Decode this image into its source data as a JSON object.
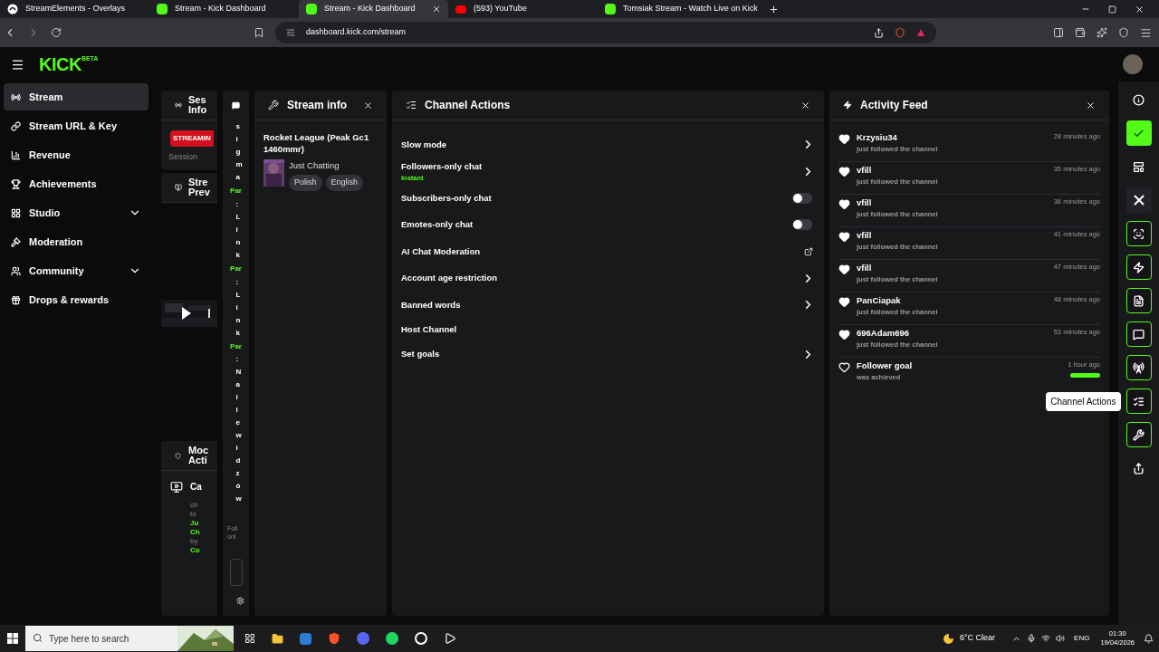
{
  "browser": {
    "tabs": [
      {
        "title": "StreamElements - Overlays",
        "kind": "streamelements",
        "selected": false
      },
      {
        "title": "Stream - Kick Dashboard",
        "kind": "kick",
        "selected": false
      },
      {
        "title": "Stream - Kick Dashboard",
        "kind": "kick",
        "selected": true
      },
      {
        "title": "(593) YouTube",
        "kind": "youtube",
        "selected": false
      },
      {
        "title": "Tomsiak Stream - Watch Live on Kick",
        "kind": "kick",
        "selected": false
      }
    ],
    "address": "dashboard.kick.com/stream"
  },
  "header": {
    "logo": "KICK",
    "badge": "BETA"
  },
  "sidebar": {
    "items": [
      {
        "label": "Stream",
        "selected": true
      },
      {
        "label": "Stream URL & Key",
        "selected": false
      },
      {
        "label": "Revenue",
        "selected": false
      },
      {
        "label": "Achievements",
        "selected": false
      },
      {
        "label": "Studio",
        "selected": false,
        "expanded": false
      },
      {
        "label": "Moderation",
        "selected": false
      },
      {
        "label": "Community",
        "selected": false,
        "expanded": false
      },
      {
        "label": "Drops & rewards",
        "selected": false
      }
    ]
  },
  "session_panel": {
    "title_lines": [
      "Ses",
      "Info"
    ],
    "status": "STREAMIN",
    "label": "Session",
    "preview_lines": [
      "Stre",
      "Prev"
    ],
    "mod_lines": [
      "Moc",
      "Acti"
    ],
    "mod_item": "Ca",
    "mod_text": [
      {
        "text": "ch",
        "green": false
      },
      {
        "text": "to",
        "green": false
      },
      {
        "text": "Ju",
        "green": true
      },
      {
        "text": "Ch",
        "green": true
      },
      {
        "text": "by",
        "green": false
      },
      {
        "text": "Co",
        "green": true
      }
    ]
  },
  "chat_panel": {
    "messages": [
      {
        "text": "sigma"
      },
      {
        "user": "Par",
        "text": ":Link"
      },
      {
        "user": "Par",
        "text": ":Link"
      },
      {
        "user": "Par",
        "text": ":Nailewidzów"
      }
    ],
    "footer_lines": [
      "Foll",
      "onl"
    ]
  },
  "stream_info": {
    "title": "Stream info",
    "stream_title": "Rocket League (Peak Gc1 1460mmr)",
    "category": "Just Chatting",
    "tags": [
      "Polish",
      "English"
    ]
  },
  "channel_actions": {
    "title": "Channel Actions",
    "rows": [
      {
        "label": "Slow mode",
        "kind": "arrow"
      },
      {
        "label": "Followers-only chat",
        "sublabel": "Instant",
        "kind": "arrow"
      },
      {
        "label": "Subscribers-only chat",
        "kind": "toggle",
        "on": false
      },
      {
        "label": "Emotes-only chat",
        "kind": "toggle",
        "on": false
      },
      {
        "label": "AI Chat Moderation",
        "kind": "external"
      },
      {
        "label": "Account age restriction",
        "kind": "arrow"
      },
      {
        "label": "Banned words",
        "kind": "arrow"
      },
      {
        "label": "Host Channel",
        "kind": "none"
      },
      {
        "label": "Set goals",
        "kind": "arrow"
      }
    ]
  },
  "activity_feed": {
    "title": "Activity Feed",
    "items": [
      {
        "name": "Krzysiu34",
        "text": "just followed the channel",
        "time": "28 minutes ago",
        "kind": "follow"
      },
      {
        "name": "vfill",
        "text": "just followed the channel",
        "time": "35 minutes ago",
        "kind": "follow"
      },
      {
        "name": "vfill",
        "text": "just followed the channel",
        "time": "36 minutes ago",
        "kind": "follow"
      },
      {
        "name": "vfill",
        "text": "just followed the channel",
        "time": "41 minutes ago",
        "kind": "follow"
      },
      {
        "name": "vfill",
        "text": "just followed the channel",
        "time": "47 minutes ago",
        "kind": "follow"
      },
      {
        "name": "PanCiapak",
        "text": "just followed the channel",
        "time": "48 minutes ago",
        "kind": "follow"
      },
      {
        "name": "696Adam696",
        "text": "just followed the channel",
        "time": "53 minutes ago",
        "kind": "follow"
      },
      {
        "name": "Follower goal",
        "text": "was achieved",
        "time": "1 hour ago",
        "kind": "goal",
        "level": 1
      }
    ]
  },
  "right_rail": {
    "buttons": [
      {
        "kind": "plain"
      },
      {
        "kind": "filled"
      },
      {
        "kind": "plain"
      },
      {
        "kind": "dark"
      },
      {
        "kind": "outlined"
      },
      {
        "kind": "outlined"
      },
      {
        "kind": "outlined"
      },
      {
        "kind": "outlined"
      },
      {
        "kind": "outlined"
      },
      {
        "kind": "outlined",
        "tooltip": "Channel Actions"
      },
      {
        "kind": "outlined"
      },
      {
        "kind": "plain"
      }
    ]
  },
  "taskbar": {
    "search_placeholder": "Type here to search",
    "weather": "6°C Clear",
    "language": "ENG",
    "time": "01:30",
    "date": "19/04/2026"
  }
}
